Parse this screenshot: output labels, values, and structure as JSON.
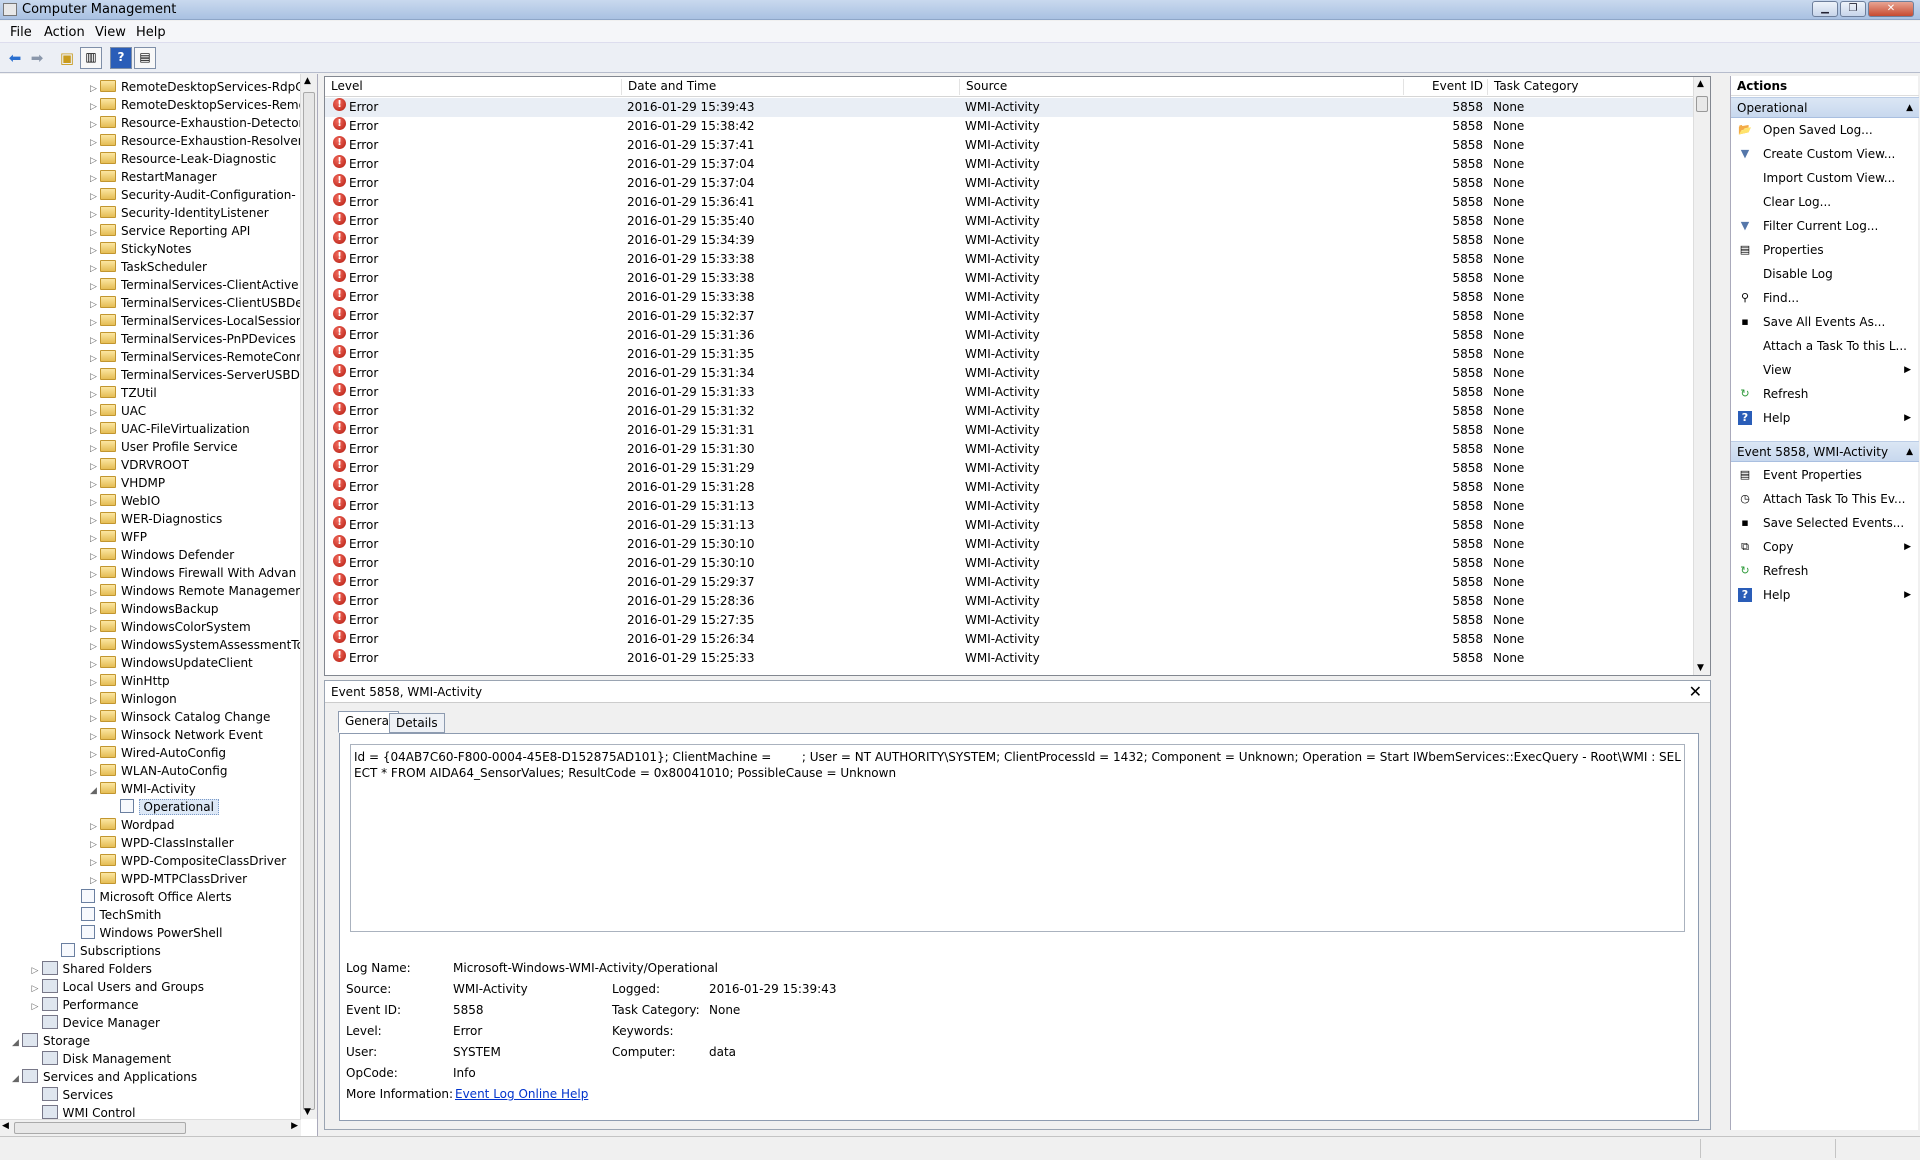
{
  "window": {
    "title": "Computer Management"
  },
  "menu": [
    "File",
    "Action",
    "View",
    "Help"
  ],
  "tree": {
    "items": [
      {
        "label": "RemoteDesktopServices-RdpC",
        "level": 4,
        "exp": "▷",
        "icon": "folder"
      },
      {
        "label": "RemoteDesktopServices-Remo",
        "level": 4,
        "exp": "▷",
        "icon": "folder"
      },
      {
        "label": "Resource-Exhaustion-Detector",
        "level": 4,
        "exp": "▷",
        "icon": "folder"
      },
      {
        "label": "Resource-Exhaustion-Resolver",
        "level": 4,
        "exp": "▷",
        "icon": "folder"
      },
      {
        "label": "Resource-Leak-Diagnostic",
        "level": 4,
        "exp": "▷",
        "icon": "folder"
      },
      {
        "label": "RestartManager",
        "level": 4,
        "exp": "▷",
        "icon": "folder"
      },
      {
        "label": "Security-Audit-Configuration-",
        "level": 4,
        "exp": "▷",
        "icon": "folder"
      },
      {
        "label": "Security-IdentityListener",
        "level": 4,
        "exp": "▷",
        "icon": "folder"
      },
      {
        "label": "Service Reporting API",
        "level": 4,
        "exp": "▷",
        "icon": "folder"
      },
      {
        "label": "StickyNotes",
        "level": 4,
        "exp": "▷",
        "icon": "folder"
      },
      {
        "label": "TaskScheduler",
        "level": 4,
        "exp": "▷",
        "icon": "folder"
      },
      {
        "label": "TerminalServices-ClientActive",
        "level": 4,
        "exp": "▷",
        "icon": "folder"
      },
      {
        "label": "TerminalServices-ClientUSBDe",
        "level": 4,
        "exp": "▷",
        "icon": "folder"
      },
      {
        "label": "TerminalServices-LocalSessior",
        "level": 4,
        "exp": "▷",
        "icon": "folder"
      },
      {
        "label": "TerminalServices-PnPDevices",
        "level": 4,
        "exp": "▷",
        "icon": "folder"
      },
      {
        "label": "TerminalServices-RemoteConr",
        "level": 4,
        "exp": "▷",
        "icon": "folder"
      },
      {
        "label": "TerminalServices-ServerUSBDe",
        "level": 4,
        "exp": "▷",
        "icon": "folder"
      },
      {
        "label": "TZUtil",
        "level": 4,
        "exp": "▷",
        "icon": "folder"
      },
      {
        "label": "UAC",
        "level": 4,
        "exp": "▷",
        "icon": "folder"
      },
      {
        "label": "UAC-FileVirtualization",
        "level": 4,
        "exp": "▷",
        "icon": "folder"
      },
      {
        "label": "User Profile Service",
        "level": 4,
        "exp": "▷",
        "icon": "folder"
      },
      {
        "label": "VDRVROOT",
        "level": 4,
        "exp": "▷",
        "icon": "folder"
      },
      {
        "label": "VHDMP",
        "level": 4,
        "exp": "▷",
        "icon": "folder"
      },
      {
        "label": "WebIO",
        "level": 4,
        "exp": "▷",
        "icon": "folder"
      },
      {
        "label": "WER-Diagnostics",
        "level": 4,
        "exp": "▷",
        "icon": "folder"
      },
      {
        "label": "WFP",
        "level": 4,
        "exp": "▷",
        "icon": "folder"
      },
      {
        "label": "Windows Defender",
        "level": 4,
        "exp": "▷",
        "icon": "folder"
      },
      {
        "label": "Windows Firewall With Advan",
        "level": 4,
        "exp": "▷",
        "icon": "folder"
      },
      {
        "label": "Windows Remote Managemer",
        "level": 4,
        "exp": "▷",
        "icon": "folder"
      },
      {
        "label": "WindowsBackup",
        "level": 4,
        "exp": "▷",
        "icon": "folder"
      },
      {
        "label": "WindowsColorSystem",
        "level": 4,
        "exp": "▷",
        "icon": "folder"
      },
      {
        "label": "WindowsSystemAssessmentTo",
        "level": 4,
        "exp": "▷",
        "icon": "folder"
      },
      {
        "label": "WindowsUpdateClient",
        "level": 4,
        "exp": "▷",
        "icon": "folder"
      },
      {
        "label": "WinHttp",
        "level": 4,
        "exp": "▷",
        "icon": "folder"
      },
      {
        "label": "Winlogon",
        "level": 4,
        "exp": "▷",
        "icon": "folder"
      },
      {
        "label": "Winsock Catalog Change",
        "level": 4,
        "exp": "▷",
        "icon": "folder"
      },
      {
        "label": "Winsock Network Event",
        "level": 4,
        "exp": "▷",
        "icon": "folder"
      },
      {
        "label": "Wired-AutoConfig",
        "level": 4,
        "exp": "▷",
        "icon": "folder"
      },
      {
        "label": "WLAN-AutoConfig",
        "level": 4,
        "exp": "▷",
        "icon": "folder"
      },
      {
        "label": "WMI-Activity",
        "level": 4,
        "exp": "◢",
        "icon": "folder"
      },
      {
        "label": "Operational",
        "level": 5,
        "exp": "",
        "icon": "log",
        "selected": true
      },
      {
        "label": "Wordpad",
        "level": 4,
        "exp": "▷",
        "icon": "folder"
      },
      {
        "label": "WPD-ClassInstaller",
        "level": 4,
        "exp": "▷",
        "icon": "folder"
      },
      {
        "label": "WPD-CompositeClassDriver",
        "level": 4,
        "exp": "▷",
        "icon": "folder"
      },
      {
        "label": "WPD-MTPClassDriver",
        "level": 4,
        "exp": "▷",
        "icon": "folder"
      },
      {
        "label": "Microsoft Office Alerts",
        "level": 3,
        "exp": "",
        "icon": "log"
      },
      {
        "label": "TechSmith",
        "level": 3,
        "exp": "",
        "icon": "log"
      },
      {
        "label": "Windows PowerShell",
        "level": 3,
        "exp": "",
        "icon": "log"
      },
      {
        "label": "Subscriptions",
        "level": 2,
        "exp": "",
        "icon": "log"
      },
      {
        "label": "Shared Folders",
        "level": 1,
        "exp": "▷",
        "icon": "tool"
      },
      {
        "label": "Local Users and Groups",
        "level": 1,
        "exp": "▷",
        "icon": "tool"
      },
      {
        "label": "Performance",
        "level": 1,
        "exp": "▷",
        "icon": "tool"
      },
      {
        "label": "Device Manager",
        "level": 1,
        "exp": "",
        "icon": "tool"
      },
      {
        "label": "Storage",
        "level": 0,
        "exp": "◢",
        "icon": "tool"
      },
      {
        "label": "Disk Management",
        "level": 1,
        "exp": "",
        "icon": "tool"
      },
      {
        "label": "Services and Applications",
        "level": 0,
        "exp": "◢",
        "icon": "tool"
      },
      {
        "label": "Services",
        "level": 1,
        "exp": "",
        "icon": "tool"
      },
      {
        "label": "WMI Control",
        "level": 1,
        "exp": "",
        "icon": "tool"
      }
    ]
  },
  "events": {
    "columns": [
      "Level",
      "Date and Time",
      "Source",
      "Event ID",
      "Task Category"
    ],
    "rows": [
      {
        "level": "Error",
        "time": "2016-01-29 15:39:43",
        "source": "WMI-Activity",
        "id": "5858",
        "cat": "None"
      },
      {
        "level": "Error",
        "time": "2016-01-29 15:38:42",
        "source": "WMI-Activity",
        "id": "5858",
        "cat": "None"
      },
      {
        "level": "Error",
        "time": "2016-01-29 15:37:41",
        "source": "WMI-Activity",
        "id": "5858",
        "cat": "None"
      },
      {
        "level": "Error",
        "time": "2016-01-29 15:37:04",
        "source": "WMI-Activity",
        "id": "5858",
        "cat": "None"
      },
      {
        "level": "Error",
        "time": "2016-01-29 15:37:04",
        "source": "WMI-Activity",
        "id": "5858",
        "cat": "None"
      },
      {
        "level": "Error",
        "time": "2016-01-29 15:36:41",
        "source": "WMI-Activity",
        "id": "5858",
        "cat": "None"
      },
      {
        "level": "Error",
        "time": "2016-01-29 15:35:40",
        "source": "WMI-Activity",
        "id": "5858",
        "cat": "None"
      },
      {
        "level": "Error",
        "time": "2016-01-29 15:34:39",
        "source": "WMI-Activity",
        "id": "5858",
        "cat": "None"
      },
      {
        "level": "Error",
        "time": "2016-01-29 15:33:38",
        "source": "WMI-Activity",
        "id": "5858",
        "cat": "None"
      },
      {
        "level": "Error",
        "time": "2016-01-29 15:33:38",
        "source": "WMI-Activity",
        "id": "5858",
        "cat": "None"
      },
      {
        "level": "Error",
        "time": "2016-01-29 15:33:38",
        "source": "WMI-Activity",
        "id": "5858",
        "cat": "None"
      },
      {
        "level": "Error",
        "time": "2016-01-29 15:32:37",
        "source": "WMI-Activity",
        "id": "5858",
        "cat": "None"
      },
      {
        "level": "Error",
        "time": "2016-01-29 15:31:36",
        "source": "WMI-Activity",
        "id": "5858",
        "cat": "None"
      },
      {
        "level": "Error",
        "time": "2016-01-29 15:31:35",
        "source": "WMI-Activity",
        "id": "5858",
        "cat": "None"
      },
      {
        "level": "Error",
        "time": "2016-01-29 15:31:34",
        "source": "WMI-Activity",
        "id": "5858",
        "cat": "None"
      },
      {
        "level": "Error",
        "time": "2016-01-29 15:31:33",
        "source": "WMI-Activity",
        "id": "5858",
        "cat": "None"
      },
      {
        "level": "Error",
        "time": "2016-01-29 15:31:32",
        "source": "WMI-Activity",
        "id": "5858",
        "cat": "None"
      },
      {
        "level": "Error",
        "time": "2016-01-29 15:31:31",
        "source": "WMI-Activity",
        "id": "5858",
        "cat": "None"
      },
      {
        "level": "Error",
        "time": "2016-01-29 15:31:30",
        "source": "WMI-Activity",
        "id": "5858",
        "cat": "None"
      },
      {
        "level": "Error",
        "time": "2016-01-29 15:31:29",
        "source": "WMI-Activity",
        "id": "5858",
        "cat": "None"
      },
      {
        "level": "Error",
        "time": "2016-01-29 15:31:28",
        "source": "WMI-Activity",
        "id": "5858",
        "cat": "None"
      },
      {
        "level": "Error",
        "time": "2016-01-29 15:31:13",
        "source": "WMI-Activity",
        "id": "5858",
        "cat": "None"
      },
      {
        "level": "Error",
        "time": "2016-01-29 15:31:13",
        "source": "WMI-Activity",
        "id": "5858",
        "cat": "None"
      },
      {
        "level": "Error",
        "time": "2016-01-29 15:30:10",
        "source": "WMI-Activity",
        "id": "5858",
        "cat": "None"
      },
      {
        "level": "Error",
        "time": "2016-01-29 15:30:10",
        "source": "WMI-Activity",
        "id": "5858",
        "cat": "None"
      },
      {
        "level": "Error",
        "time": "2016-01-29 15:29:37",
        "source": "WMI-Activity",
        "id": "5858",
        "cat": "None"
      },
      {
        "level": "Error",
        "time": "2016-01-29 15:28:36",
        "source": "WMI-Activity",
        "id": "5858",
        "cat": "None"
      },
      {
        "level": "Error",
        "time": "2016-01-29 15:27:35",
        "source": "WMI-Activity",
        "id": "5858",
        "cat": "None"
      },
      {
        "level": "Error",
        "time": "2016-01-29 15:26:34",
        "source": "WMI-Activity",
        "id": "5858",
        "cat": "None"
      },
      {
        "level": "Error",
        "time": "2016-01-29 15:25:33",
        "source": "WMI-Activity",
        "id": "5858",
        "cat": "None"
      }
    ]
  },
  "detail": {
    "title": "Event 5858, WMI-Activity",
    "tabs": [
      "General",
      "Details"
    ],
    "description": "Id = {04AB7C60-F800-0004-45E8-D152875AD101}; ClientMachine =        ; User = NT AUTHORITY\\SYSTEM; ClientProcessId = 1432; Component = Unknown; Operation = Start IWbemServices::ExecQuery - Root\\WMI : SELECT * FROM AIDA64_SensorValues; ResultCode = 0x80041010; PossibleCause = Unknown",
    "labels": {
      "log_name": "Log Name:",
      "source": "Source:",
      "event_id": "Event ID:",
      "level": "Level:",
      "user": "User:",
      "opcode": "OpCode:",
      "more_info": "More Information:",
      "logged": "Logged:",
      "task_category": "Task Category:",
      "keywords": "Keywords:",
      "computer": "Computer:"
    },
    "values": {
      "log_name": "Microsoft-Windows-WMI-Activity/Operational",
      "source": "WMI-Activity",
      "event_id": "5858",
      "level": "Error",
      "user": "SYSTEM",
      "opcode": "Info",
      "more_info_link": "Event Log Online Help",
      "logged": "2016-01-29 15:39:43",
      "task_category": "None",
      "keywords": "",
      "computer": "data"
    }
  },
  "actions": {
    "header": "Actions",
    "section1": "Operational",
    "items1": [
      {
        "label": "Open Saved Log...",
        "icon": "📂",
        "sub": false
      },
      {
        "label": "Create Custom View...",
        "icon": "▼",
        "sub": false
      },
      {
        "label": "Import Custom View...",
        "icon": "",
        "sub": false
      },
      {
        "label": "Clear Log...",
        "icon": "",
        "sub": false
      },
      {
        "label": "Filter Current Log...",
        "icon": "▼",
        "sub": false
      },
      {
        "label": "Properties",
        "icon": "▤",
        "sub": false
      },
      {
        "label": "Disable Log",
        "icon": "",
        "sub": false
      },
      {
        "label": "Find...",
        "icon": "⚲",
        "sub": false
      },
      {
        "label": "Save All Events As...",
        "icon": "▪",
        "sub": false
      },
      {
        "label": "Attach a Task To this L...",
        "icon": "",
        "sub": false
      },
      {
        "label": "View",
        "icon": "",
        "sub": true
      },
      {
        "label": "Refresh",
        "icon": "↻",
        "sub": false
      },
      {
        "label": "Help",
        "icon": "?",
        "sub": true
      }
    ],
    "section2": "Event 5858, WMI-Activity",
    "items2": [
      {
        "label": "Event Properties",
        "icon": "▤",
        "sub": false
      },
      {
        "label": "Attach Task To This Ev...",
        "icon": "◷",
        "sub": false
      },
      {
        "label": "Save Selected Events...",
        "icon": "▪",
        "sub": false
      },
      {
        "label": "Copy",
        "icon": "⧉",
        "sub": true
      },
      {
        "label": "Refresh",
        "icon": "↻",
        "sub": false
      },
      {
        "label": "Help",
        "icon": "?",
        "sub": true
      }
    ]
  }
}
